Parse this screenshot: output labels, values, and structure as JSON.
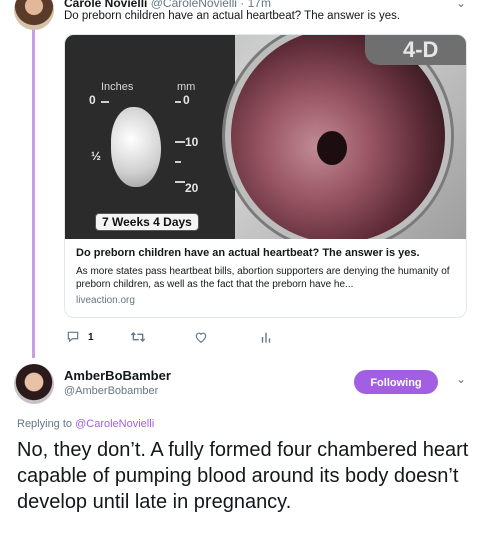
{
  "parent_tweet": {
    "name": "Carole Novielli",
    "handle": "@CaroleNovielli",
    "separator": "·",
    "time": "17m",
    "text": "Do preborn children have an actual heartbeat? The answer is yes.",
    "card": {
      "image": {
        "ruler_unit_left": "Inches",
        "ruler_unit_right": "mm",
        "ruler_zero_left": "0",
        "ruler_zero_right": "0",
        "ruler_half": "½",
        "ruler_ten": "10",
        "ruler_twenty": "20",
        "badge": "7 Weeks 4 Days",
        "logo": "4-D"
      },
      "title": "Do preborn children have an actual heartbeat? The answer is yes.",
      "description": "As more states pass heartbeat bills, abortion supporters are denying the humanity of preborn children, as well as the fact that the preborn have he...",
      "domain": "liveaction.org"
    },
    "actions": {
      "reply_count": "1",
      "reply_icon": "reply-icon",
      "retweet_icon": "retweet-icon",
      "like_icon": "heart-icon",
      "analytics_icon": "analytics-icon"
    }
  },
  "reply_tweet": {
    "name": "AmberBoBamber",
    "handle": "@AmberBobamber",
    "follow_label": "Following",
    "replying_to_prefix": "Replying to",
    "replying_to_handle": "@CaroleNovielli",
    "text": "No, they don’t. A fully formed four chambered heart capable of pumping blood around its body doesn’t develop until late in pregnancy."
  },
  "colors": {
    "accent": "#a35fe3",
    "thread_line": "#c6a0e6",
    "secondary_text": "#657786"
  }
}
